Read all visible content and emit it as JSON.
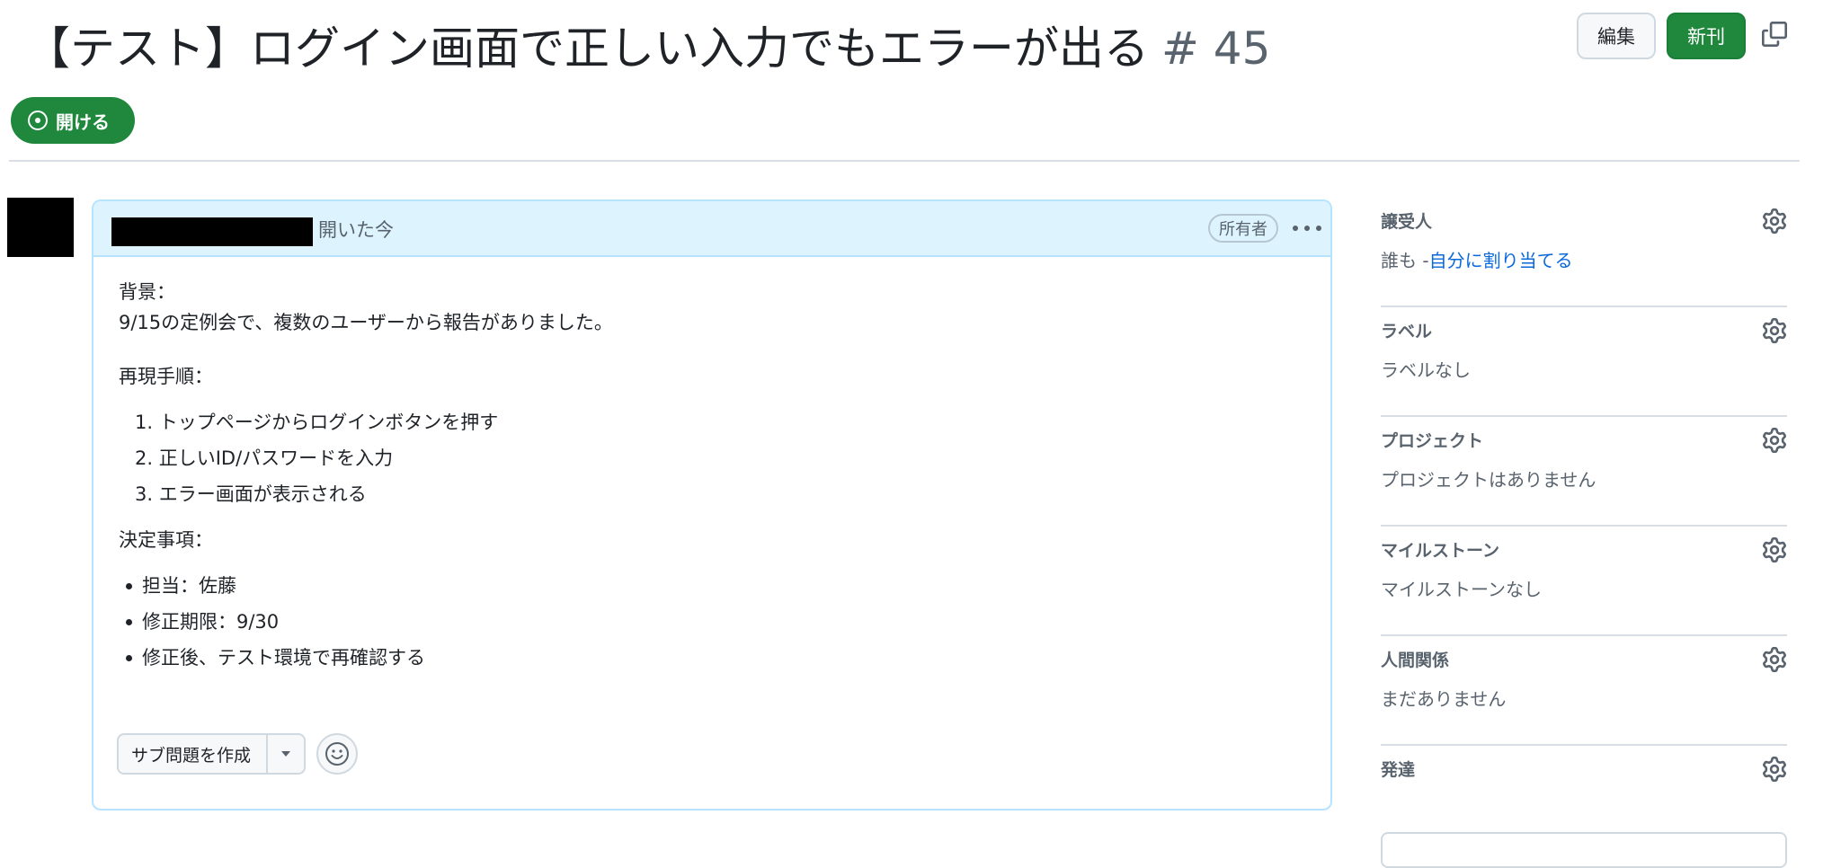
{
  "issue": {
    "title": "【テスト】ログイン画面で正しい入力でもエラーが出る",
    "number": "# 45",
    "state": "開ける",
    "edit_label": "編集",
    "new_label": "新刊"
  },
  "comment": {
    "opened_text": "開いた今",
    "owner_badge": "所有者",
    "background_label": "背景：",
    "background_text": "9/15の定例会で、複数のユーザーから報告がありました。",
    "repro_label": "再現手順：",
    "steps": [
      "1. トップページからログインボタンを押す",
      "2. 正しいID/パスワードを入力",
      "3. エラー画面が表示される"
    ],
    "decision_label": "決定事項：",
    "decisions": [
      "担当：佐藤",
      "修正期限：9/30",
      "修正後、テスト環境で再確認する"
    ],
    "subissue_button": "サブ問題を作成"
  },
  "sidebar": {
    "assignees": {
      "title": "譲受人",
      "none": "誰も -",
      "link": "自分に割り当てる"
    },
    "labels": {
      "title": "ラベル",
      "value": "ラベルなし"
    },
    "projects": {
      "title": "プロジェクト",
      "value": "プロジェクトはありません"
    },
    "milestone": {
      "title": "マイルストーン",
      "value": "マイルストーンなし"
    },
    "relationships": {
      "title": "人間関係",
      "value": "まだありません"
    },
    "development": {
      "title": "発達"
    }
  },
  "colors": {
    "accent_green": "#1f883d",
    "link_blue": "#0969da",
    "comment_header": "#ddf4ff"
  }
}
